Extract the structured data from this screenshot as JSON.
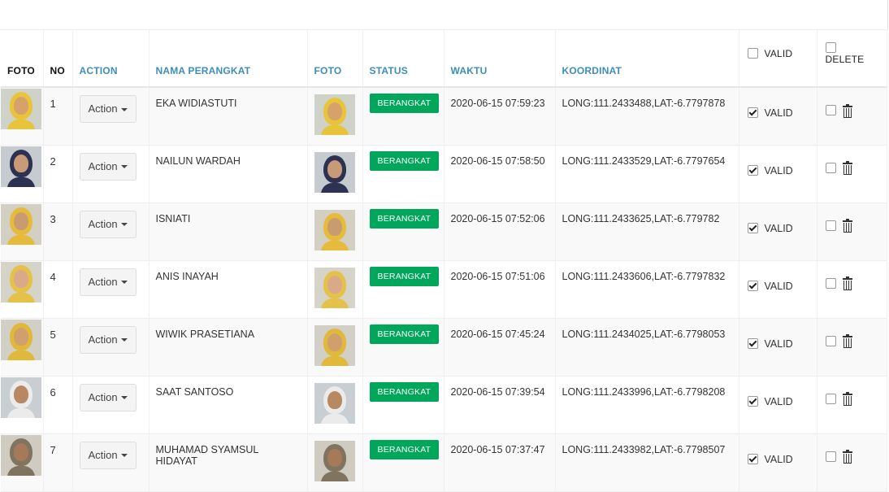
{
  "table": {
    "headers": {
      "foto": "FOTO",
      "no": "NO",
      "action": "ACTION",
      "nama": "NAMA PERANGKAT",
      "foto2": "FOTO",
      "status": "STATUS",
      "waktu": "WAKTU",
      "koordinat": "KOORDINAT",
      "valid": "VALID",
      "delete": "DELETE"
    },
    "rows": [
      {
        "no": "1",
        "action": "Action",
        "nama": "EKA WIDIASTUTI",
        "status": "BERANGKAT",
        "waktu": "2020-06-15 07:59:23",
        "koordinat": "LONG:111.2433488,LAT:-6.7797878",
        "valid": "VALID",
        "valid_checked": true,
        "delete_checked": false
      },
      {
        "no": "2",
        "action": "Action",
        "nama": "NAILUN WARDAH",
        "status": "BERANGKAT",
        "waktu": "2020-06-15 07:58:50",
        "koordinat": "LONG:111.2433529,LAT:-6.7797654",
        "valid": "VALID",
        "valid_checked": true,
        "delete_checked": false
      },
      {
        "no": "3",
        "action": "Action",
        "nama": "ISNIATI",
        "status": "BERANGKAT",
        "waktu": "2020-06-15 07:52:06",
        "koordinat": "LONG:111.2433625,LAT:-6.779782",
        "valid": "VALID",
        "valid_checked": true,
        "delete_checked": false
      },
      {
        "no": "4",
        "action": "Action",
        "nama": "ANIS INAYAH",
        "status": "BERANGKAT",
        "waktu": "2020-06-15 07:51:06",
        "koordinat": "LONG:111.2433606,LAT:-6.7797832",
        "valid": "VALID",
        "valid_checked": true,
        "delete_checked": false
      },
      {
        "no": "5",
        "action": "Action",
        "nama": "WIWIK PRASETIANA",
        "status": "BERANGKAT",
        "waktu": "2020-06-15 07:45:24",
        "koordinat": "LONG:111.2434025,LAT:-6.7798053",
        "valid": "VALID",
        "valid_checked": true,
        "delete_checked": false
      },
      {
        "no": "6",
        "action": "Action",
        "nama": "SAAT SANTOSO",
        "status": "BERANGKAT",
        "waktu": "2020-06-15 07:39:54",
        "koordinat": "LONG:111.2433996,LAT:-6.7798208",
        "valid": "VALID",
        "valid_checked": true,
        "delete_checked": false
      },
      {
        "no": "7",
        "action": "Action",
        "nama": "MUHAMAD SYAMSUL HIDAYAT",
        "status": "BERANGKAT",
        "waktu": "2020-06-15 07:37:47",
        "koordinat": "LONG:111.2433982,LAT:-6.7798507",
        "valid": "VALID",
        "valid_checked": true,
        "delete_checked": false
      }
    ]
  },
  "colors": {
    "status_badge": "#00a65a",
    "header_link": "#3c8dbc",
    "stripe": "#f9f9f9"
  },
  "icons": {
    "delete": "trash-icon",
    "action_dropdown": "caret-down-icon"
  }
}
